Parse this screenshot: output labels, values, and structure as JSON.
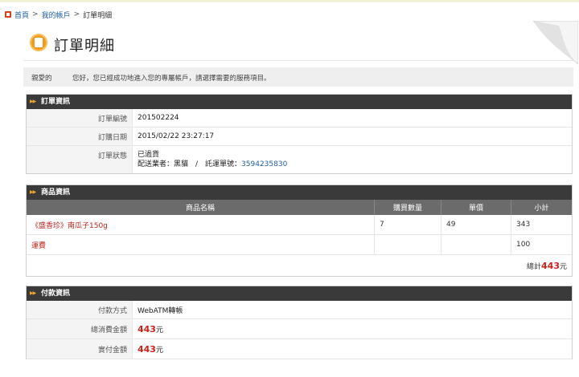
{
  "breadcrumb": {
    "home": "首頁",
    "sep": ">",
    "account": "我的帳戶",
    "current": "訂單明細"
  },
  "page": {
    "title": "訂單明細"
  },
  "greeting": {
    "text": "親愛的　　　您好，您已經成功地進入您的專屬帳戶，請選擇需要的服務項目。"
  },
  "order_info": {
    "heading": "訂單資訊",
    "number_label": "訂單編號",
    "number_value": "201502224",
    "date_label": "訂購日期",
    "date_value": "2015/02/22 23:27:17",
    "status_label": "訂單狀態",
    "status_value": "已過貨",
    "shipping_text": "配送業者：黑貓　/　託運單號：",
    "tracking_number": "3594235830"
  },
  "product_info": {
    "heading": "商品資訊",
    "columns": [
      "商品名稱",
      "購買數量",
      "單價",
      "小計"
    ],
    "rows": [
      {
        "name": "《盛香珍》南瓜子150g",
        "qty": "7",
        "price": "49",
        "subtotal": "343"
      },
      {
        "name": "運費",
        "qty": "",
        "price": "",
        "subtotal": "100"
      }
    ],
    "total_label": "總計",
    "total_value": "443",
    "total_unit": "元"
  },
  "payment_info": {
    "heading": "付款資訊",
    "method_label": "付款方式",
    "method_value": "WebATM轉帳",
    "consume_label": "總消費金額",
    "consume_value": "443",
    "consume_unit": "元",
    "paid_label": "實付金額",
    "paid_value": "443",
    "paid_unit": "元"
  }
}
